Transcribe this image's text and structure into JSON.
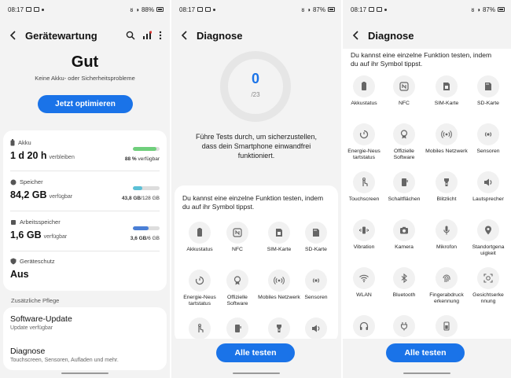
{
  "status": {
    "p1": {
      "time": "08:17",
      "battery": "88%"
    },
    "p2": {
      "time": "08:17",
      "battery": "87%"
    },
    "p3": {
      "time": "08:17",
      "battery": "87%"
    }
  },
  "device_care": {
    "title": "Gerätewartung",
    "state": "Gut",
    "state_sub": "Keine Akku- oder Sicherheitsprobleme",
    "optimize_label": "Jetzt optimieren",
    "battery": {
      "label": "Akku",
      "value": "1 d 20 h",
      "suffix": "verbleiben",
      "info_bold": "88 %",
      "info_rest": "verfügbar",
      "fill": 0.88,
      "color": "#6fcf7c"
    },
    "storage": {
      "label": "Speicher",
      "value": "84,2 GB",
      "suffix": "verfügbar",
      "info_bold": "43,8 GB",
      "info_rest": "/128 GB",
      "fill": 0.34,
      "color": "#5bc0d6"
    },
    "ram": {
      "label": "Arbeitsspeicher",
      "value": "1,6 GB",
      "suffix": "verfügbar",
      "info_bold": "3,6 GB",
      "info_rest": "/6 GB",
      "fill": 0.6,
      "color": "#4a7fd6"
    },
    "protection": {
      "label": "Geräteschutz",
      "value": "Aus"
    },
    "extra_label": "Zusätzliche Pflege",
    "software_update": {
      "title": "Software-Update",
      "sub": "Update verfügbar"
    },
    "diagnostics": {
      "title": "Diagnose",
      "sub": "Touchscreen, Sensoren, Aufladen und mehr."
    }
  },
  "diagnose": {
    "title": "Diagnose",
    "count": "0",
    "total": "/23",
    "message": "Führe Tests durch, um sicherzustellen, dass dein Smartphone einwandfrei funktioniert.",
    "intro": "Du kannst eine einzelne Funktion testen, indem du auf ihr Symbol tippst.",
    "test_all_label": "Alle testen",
    "tests": [
      {
        "label": "Akkustatus",
        "icon": "battery-icon"
      },
      {
        "label": "NFC",
        "icon": "nfc-icon"
      },
      {
        "label": "SIM-Karte",
        "icon": "sim-card-icon"
      },
      {
        "label": "SD-Karte",
        "icon": "sd-card-icon"
      },
      {
        "label": "Energie-Neus tartstatus",
        "icon": "restart-icon"
      },
      {
        "label": "Offizielle Software",
        "icon": "badge-icon"
      },
      {
        "label": "Mobiles Netzwerk",
        "icon": "signal-icon"
      },
      {
        "label": "Sensoren",
        "icon": "sensor-icon"
      },
      {
        "label": "Touchscreen",
        "icon": "touch-icon"
      },
      {
        "label": "Schaltflächen",
        "icon": "buttons-icon"
      },
      {
        "label": "Blitzlicht",
        "icon": "flashlight-icon"
      },
      {
        "label": "Lautsprecher",
        "icon": "speaker-icon"
      },
      {
        "label": "Vibration",
        "icon": "vibration-icon"
      },
      {
        "label": "Kamera",
        "icon": "camera-icon"
      },
      {
        "label": "Mikrofon",
        "icon": "microphone-icon"
      },
      {
        "label": "Standortgena uigkeit",
        "icon": "location-icon"
      },
      {
        "label": "WLAN",
        "icon": "wifi-icon"
      },
      {
        "label": "Bluetooth",
        "icon": "bluetooth-icon"
      },
      {
        "label": "Fingerabdruck erkennung",
        "icon": "fingerprint-icon"
      },
      {
        "label": "Gesichtserke nnung",
        "icon": "face-icon"
      },
      {
        "label": "",
        "icon": "headphones-icon"
      },
      {
        "label": "",
        "icon": "charging-icon"
      },
      {
        "label": "",
        "icon": "battery-alt-icon"
      }
    ]
  }
}
